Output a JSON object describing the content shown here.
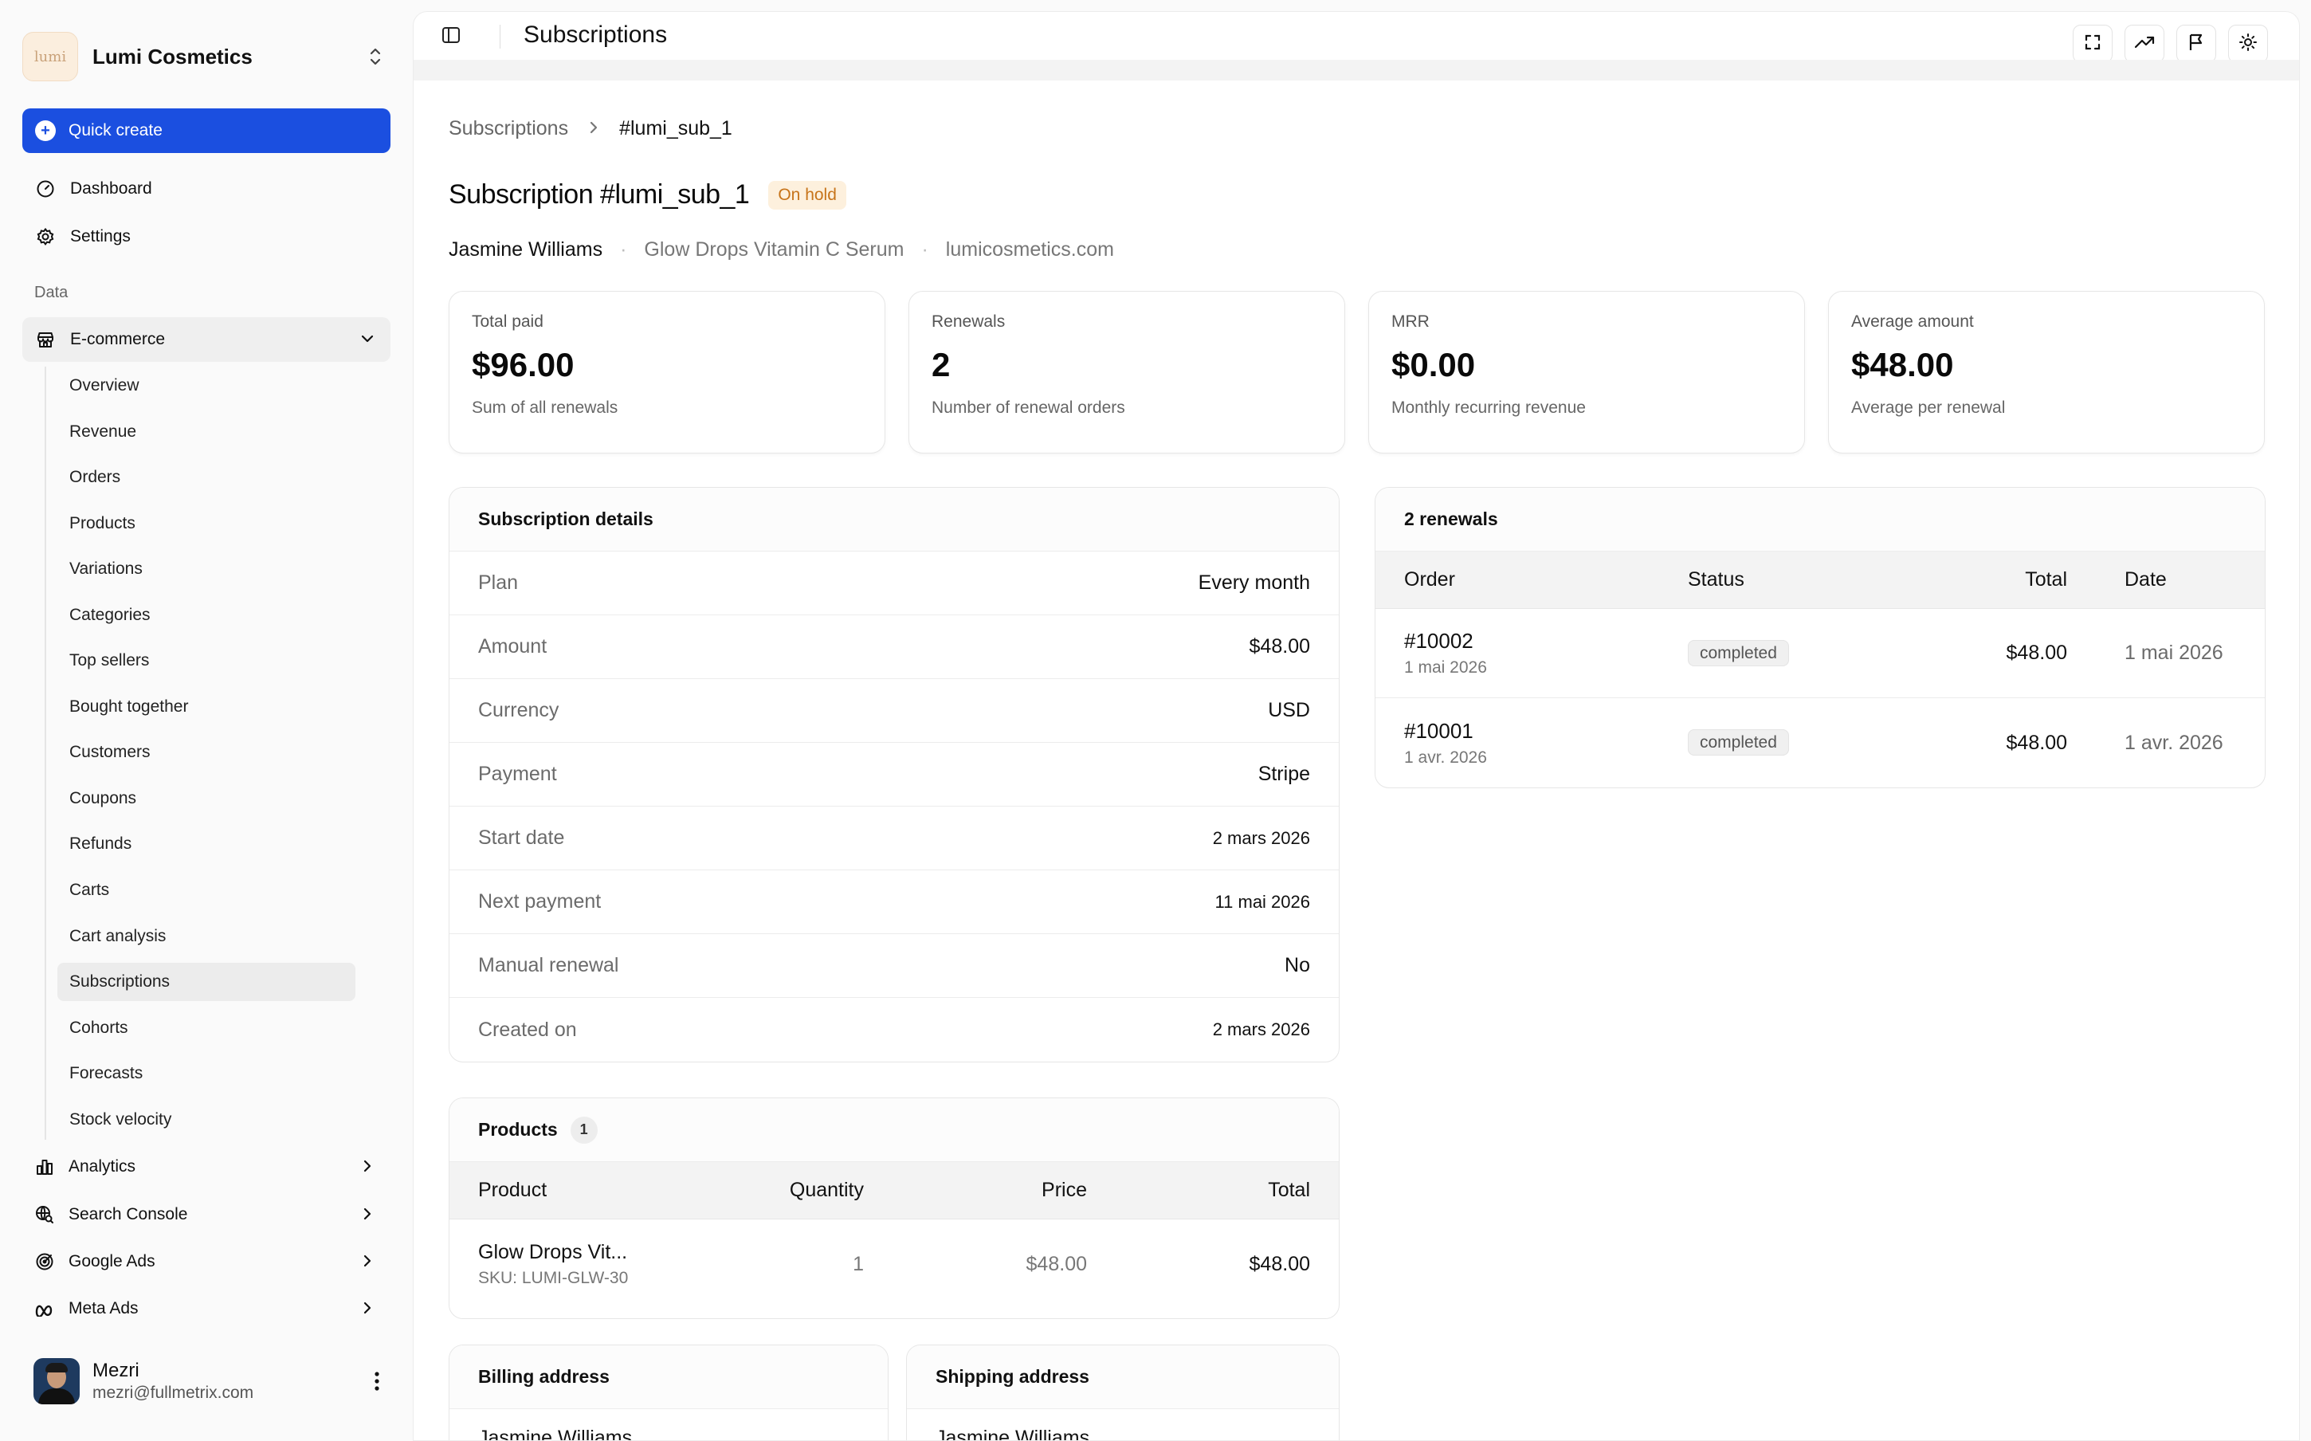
{
  "brand": {
    "name": "Lumi Cosmetics",
    "logo_text": "lumi"
  },
  "quick_create": "Quick create",
  "nav": {
    "dashboard": "Dashboard",
    "settings": "Settings"
  },
  "section_label": "Data",
  "ecommerce": {
    "label": "E-commerce",
    "items": [
      "Overview",
      "Revenue",
      "Orders",
      "Products",
      "Variations",
      "Categories",
      "Top sellers",
      "Bought together",
      "Customers",
      "Coupons",
      "Refunds",
      "Carts",
      "Cart analysis",
      "Subscriptions",
      "Cohorts",
      "Forecasts",
      "Stock velocity"
    ],
    "active_index": 13
  },
  "groups": [
    "Analytics",
    "Search Console",
    "Google Ads",
    "Meta Ads"
  ],
  "user": {
    "name": "Mezri",
    "email": "mezri@fullmetrix.com"
  },
  "topbar": {
    "title": "Subscriptions"
  },
  "breadcrumb": {
    "parent": "Subscriptions",
    "current": "#lumi_sub_1"
  },
  "page": {
    "title": "Subscription #lumi_sub_1",
    "status": "On hold",
    "customer": "Jasmine Williams",
    "product": "Glow Drops Vitamin C Serum",
    "site": "lumicosmetics.com"
  },
  "stats": [
    {
      "label": "Total paid",
      "value": "$96.00",
      "sub": "Sum of all renewals"
    },
    {
      "label": "Renewals",
      "value": "2",
      "sub": "Number of renewal orders"
    },
    {
      "label": "MRR",
      "value": "$0.00",
      "sub": "Monthly recurring revenue"
    },
    {
      "label": "Average amount",
      "value": "$48.00",
      "sub": "Average per renewal"
    }
  ],
  "details": {
    "title": "Subscription details",
    "rows": [
      {
        "key": "Plan",
        "value": "Every month"
      },
      {
        "key": "Amount",
        "value": "$48.00"
      },
      {
        "key": "Currency",
        "value": "USD"
      },
      {
        "key": "Payment",
        "value": "Stripe"
      },
      {
        "key": "Start date",
        "value": "2 mars 2026"
      },
      {
        "key": "Next payment",
        "value": "11 mai 2026"
      },
      {
        "key": "Manual renewal",
        "value": "No"
      },
      {
        "key": "Created on",
        "value": "2 mars 2026"
      }
    ]
  },
  "renewals": {
    "title": "2 renewals",
    "headers": {
      "order": "Order",
      "status": "Status",
      "total": "Total",
      "date": "Date"
    },
    "rows": [
      {
        "order": "#10002",
        "order_date": "1 mai 2026",
        "status": "completed",
        "total": "$48.00",
        "date": "1 mai 2026"
      },
      {
        "order": "#10001",
        "order_date": "1 avr. 2026",
        "status": "completed",
        "total": "$48.00",
        "date": "1 avr. 2026"
      }
    ]
  },
  "products": {
    "title": "Products",
    "count": "1",
    "headers": {
      "product": "Product",
      "quantity": "Quantity",
      "price": "Price",
      "total": "Total"
    },
    "rows": [
      {
        "name": "Glow Drops Vit...",
        "sku": "SKU: LUMI-GLW-30",
        "quantity": "1",
        "price": "$48.00",
        "total": "$48.00"
      }
    ]
  },
  "billing": {
    "title": "Billing address",
    "name": "Jasmine Williams"
  },
  "shipping": {
    "title": "Shipping address",
    "name": "Jasmine Williams"
  },
  "colors": {
    "accent": "#1b4fe0",
    "on_hold_bg": "#fdf0dd",
    "on_hold_text": "#c7741a"
  }
}
